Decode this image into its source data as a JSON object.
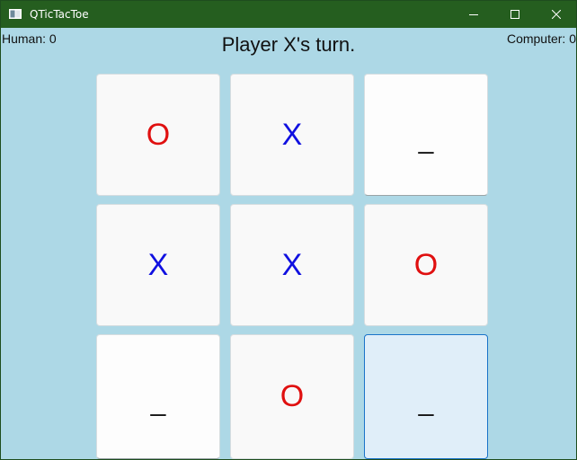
{
  "window": {
    "title": "QTicTacToe",
    "icon": "app-window-icon",
    "controls": [
      "minimize-icon",
      "maximize-icon",
      "close-icon"
    ]
  },
  "scores": {
    "human": "Human: 0",
    "computer": "Computer: 0"
  },
  "status": "Player X's turn.",
  "board": {
    "cells": [
      "O",
      "X",
      "_",
      "X",
      "X",
      "O",
      "_",
      "O",
      "_"
    ],
    "focused_cell": 8
  },
  "colors": {
    "background": "#add8e6",
    "titlebar": "#255e1f",
    "mark_o": "#e01010",
    "mark_x": "#1010e0",
    "focus_border": "#1a73c9"
  }
}
